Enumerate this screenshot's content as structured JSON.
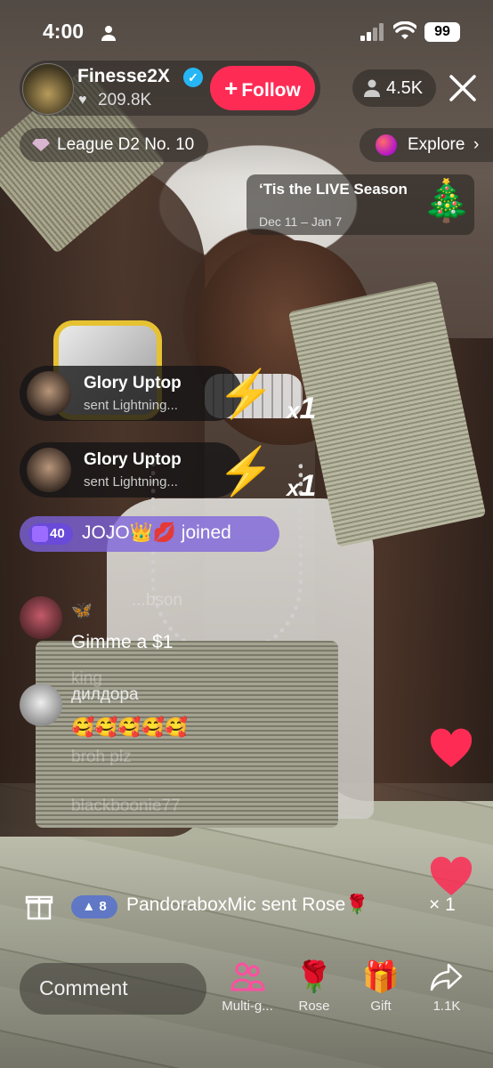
{
  "status_bar": {
    "time": "4:00",
    "battery": "99"
  },
  "host": {
    "name": "Finesse2X",
    "likes": "209.8K",
    "follow_label": "Follow"
  },
  "viewers": {
    "count": "4.5K"
  },
  "league": {
    "label": "League D2 No. 10"
  },
  "explore": {
    "label": "Explore"
  },
  "season": {
    "title": "‘Tis the LIVE Season",
    "dates": "Dec 11 – Jan 7",
    "icon": "🎄"
  },
  "gifts": [
    {
      "user": "Glory Uptop",
      "text": "sent Lightning...",
      "count": "1",
      "x": "x"
    },
    {
      "user": "Glory Uptop",
      "text": "sent Lightning...",
      "count": "1",
      "x": "x"
    }
  ],
  "joined": {
    "level": "40",
    "text": "JOJO👑💋 joined"
  },
  "chat": [
    {
      "name": "🦋",
      "message": "Gimme a $1"
    },
    {
      "name": "дилдора",
      "message": "🥰🥰🥰🥰🥰"
    }
  ],
  "faded_chat": [
    "...bson",
    "king",
    "broh plz",
    "blackboonie77"
  ],
  "rose_notice": {
    "level": "8",
    "text": "PandoraboxMic sent Rose🌹",
    "count": "× 1"
  },
  "comment": {
    "placeholder": "Comment"
  },
  "toolbar": [
    {
      "label": "Multi-g...",
      "icon": "multi-guest-icon"
    },
    {
      "label": "Rose",
      "icon": "rose-icon"
    },
    {
      "label": "Gift",
      "icon": "gift-icon"
    },
    {
      "label": "1.1K",
      "icon": "share-icon"
    }
  ],
  "colors": {
    "follow": "#fe2c55",
    "verified": "#26b6f5",
    "joined": "#7e64dc",
    "heart": "#fe2c55"
  }
}
